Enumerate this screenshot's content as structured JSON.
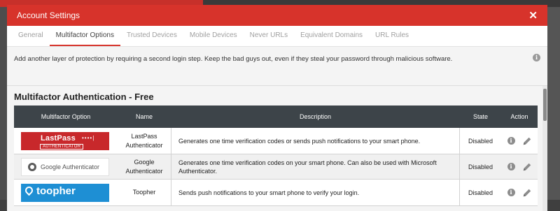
{
  "modal": {
    "title": "Account Settings",
    "close_glyph": "✕"
  },
  "tabs": [
    {
      "label": "General",
      "active": false
    },
    {
      "label": "Multifactor Options",
      "active": true
    },
    {
      "label": "Trusted Devices",
      "active": false
    },
    {
      "label": "Mobile Devices",
      "active": false
    },
    {
      "label": "Never URLs",
      "active": false
    },
    {
      "label": "Equivalent Domains",
      "active": false
    },
    {
      "label": "URL Rules",
      "active": false
    }
  ],
  "info": {
    "text": "Add another layer of protection by requiring a second login step. Keep the bad guys out, even if they steal your password through malicious software.",
    "icon": "info-icon"
  },
  "section": {
    "title": "Multifactor Authentication - Free"
  },
  "table": {
    "headers": {
      "option": "Multifactor Option",
      "name": "Name",
      "description": "Description",
      "state": "State",
      "action": "Action"
    },
    "rows": [
      {
        "logo": {
          "word": "LastPass",
          "dots": "••••|",
          "sub": "AUTHENTICATOR"
        },
        "name": "LastPass Authenticator",
        "description": "Generates one time verification codes or sends push notifications to your smart phone.",
        "state": "Disabled"
      },
      {
        "logo": {
          "word": "Google Authenticator"
        },
        "name": "Google Authenticator",
        "description": "Generates one time verification codes on your smart phone. Can also be used with Microsoft Authenticator.",
        "state": "Disabled"
      },
      {
        "logo": {
          "word": "toopher"
        },
        "name": "Toopher",
        "description": "Sends push notifications to your smart phone to verify your login.",
        "state": "Disabled"
      }
    ]
  },
  "colors": {
    "accent": "#d7332b",
    "table_header": "#3d4449",
    "lastpass_red": "#c8282b",
    "toopher_blue": "#1e8fd4"
  }
}
